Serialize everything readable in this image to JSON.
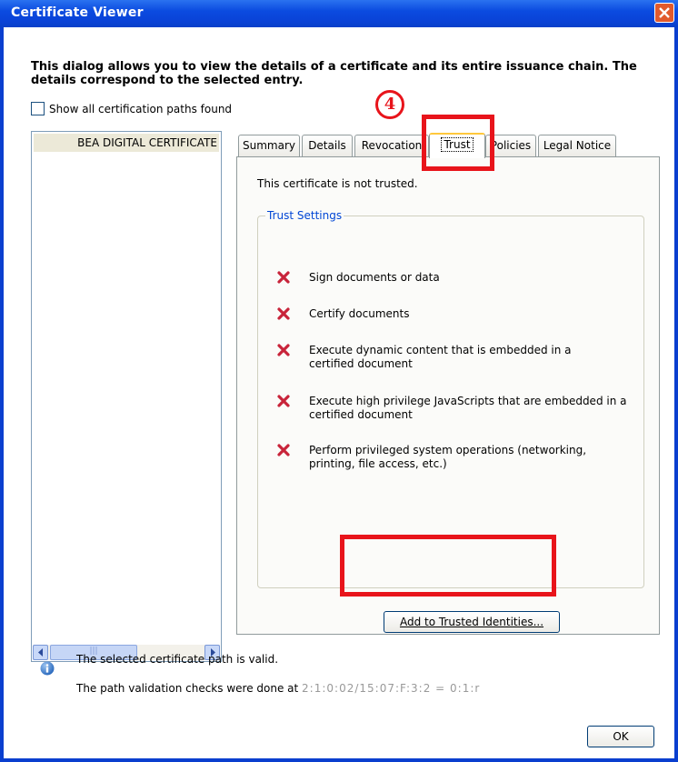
{
  "window": {
    "title": "Certificate Viewer"
  },
  "intro_text": "This dialog allows you to view the details of a certificate and its entire issuance chain. The details correspond to the selected entry.",
  "show_all_paths": {
    "label": "Show all certification paths found",
    "checked": false
  },
  "cert_tree": {
    "items": [
      "BEA DIGITAL CERTIFICATE"
    ]
  },
  "tabs": [
    {
      "label": "Summary",
      "active": false
    },
    {
      "label": "Details",
      "active": false
    },
    {
      "label": "Revocation",
      "active": false
    },
    {
      "label": "Trust",
      "active": true
    },
    {
      "label": "Policies",
      "active": false
    },
    {
      "label": "Legal Notice",
      "active": false
    }
  ],
  "trust_panel": {
    "status_text": "This certificate is not trusted.",
    "group_title": "Trust Settings",
    "permissions": [
      {
        "icon": "red-x-icon",
        "text": "Sign documents or data"
      },
      {
        "icon": "red-x-icon",
        "text": "Certify documents"
      },
      {
        "icon": "red-x-icon",
        "text": "Execute dynamic content that is embedded in a certified document"
      },
      {
        "icon": "red-x-icon",
        "text": "Execute high privilege JavaScripts that are embedded in a certified document"
      },
      {
        "icon": "red-x-icon",
        "text": "Perform privileged system operations (networking, printing, file access, etc.)"
      }
    ],
    "add_button_label": "Add to Trusted Identities..."
  },
  "annotation": {
    "step_number": "4",
    "color": "#e8141b"
  },
  "status": {
    "line1": "The selected certificate path is valid.",
    "line2": "The path validation checks were done at",
    "line2_obscured": "2:1:0:02/15:07:F:3:2 = 0:1:r"
  },
  "footer": {
    "ok_label": "OK"
  },
  "colors": {
    "titlebar": "#0a42d6",
    "accent_blue": "#0046d5",
    "highlight_red": "#e8141b"
  }
}
